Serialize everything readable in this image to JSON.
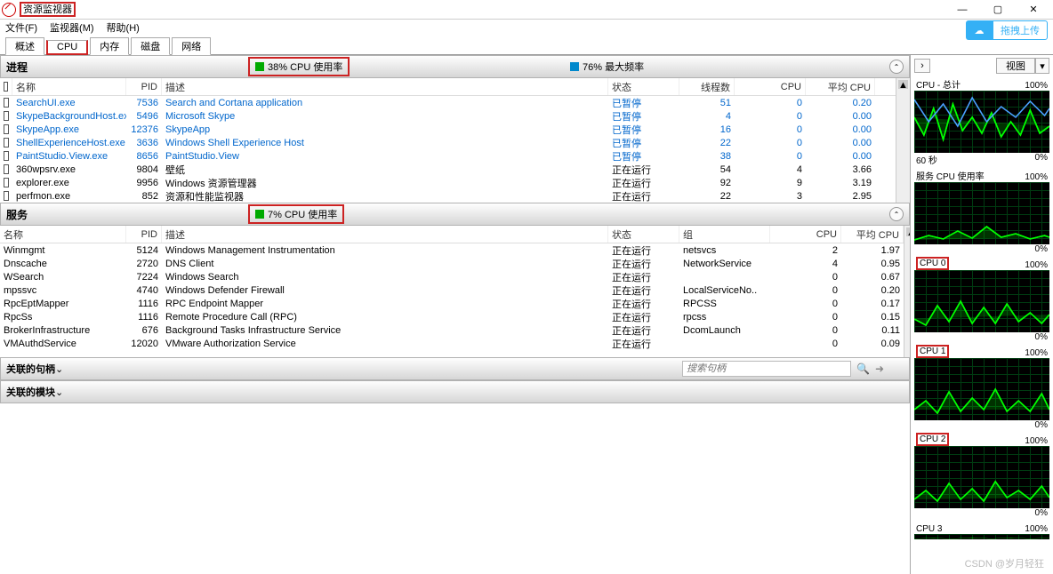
{
  "window": {
    "title": "资源监视器"
  },
  "menu": {
    "file": "文件(F)",
    "monitor": "监视器(M)",
    "help": "帮助(H)"
  },
  "upload_btn": "拖拽上传",
  "tabs": {
    "overview": "概述",
    "cpu": "CPU",
    "memory": "内存",
    "disk": "磁盘",
    "network": "网络"
  },
  "proc_section": {
    "title": "进程",
    "stat1": "38% CPU 使用率",
    "stat2": "76% 最大频率",
    "headers": {
      "name": "名称",
      "pid": "PID",
      "desc": "描述",
      "status": "状态",
      "threads": "线程数",
      "cpu": "CPU",
      "avgcpu": "平均 CPU"
    },
    "rows": [
      {
        "name": "SearchUI.exe",
        "pid": "7536",
        "desc": "Search and Cortana application",
        "status": "已暂停",
        "threads": "51",
        "cpu": "0",
        "avg": "0.20",
        "link": true
      },
      {
        "name": "SkypeBackgroundHost.exe",
        "pid": "5496",
        "desc": "Microsoft Skype",
        "status": "已暂停",
        "threads": "4",
        "cpu": "0",
        "avg": "0.00",
        "link": true
      },
      {
        "name": "SkypeApp.exe",
        "pid": "12376",
        "desc": "SkypeApp",
        "status": "已暂停",
        "threads": "16",
        "cpu": "0",
        "avg": "0.00",
        "link": true
      },
      {
        "name": "ShellExperienceHost.exe",
        "pid": "3636",
        "desc": "Windows Shell Experience Host",
        "status": "已暂停",
        "threads": "22",
        "cpu": "0",
        "avg": "0.00",
        "link": true
      },
      {
        "name": "PaintStudio.View.exe",
        "pid": "8656",
        "desc": "PaintStudio.View",
        "status": "已暂停",
        "threads": "38",
        "cpu": "0",
        "avg": "0.00",
        "link": true
      },
      {
        "name": "360wpsrv.exe",
        "pid": "9804",
        "desc": "壁纸",
        "status": "正在运行",
        "threads": "54",
        "cpu": "4",
        "avg": "3.66",
        "link": false
      },
      {
        "name": "explorer.exe",
        "pid": "9956",
        "desc": "Windows 资源管理器",
        "status": "正在运行",
        "threads": "92",
        "cpu": "9",
        "avg": "3.19",
        "link": false
      },
      {
        "name": "perfmon.exe",
        "pid": "852",
        "desc": "资源和性能监视器",
        "status": "正在运行",
        "threads": "22",
        "cpu": "3",
        "avg": "2.95",
        "link": false
      }
    ]
  },
  "svc_section": {
    "title": "服务",
    "stat1": "7% CPU 使用率",
    "headers": {
      "name": "名称",
      "pid": "PID",
      "desc": "描述",
      "status": "状态",
      "group": "组",
      "cpu": "CPU",
      "avgcpu": "平均 CPU"
    },
    "rows": [
      {
        "name": "Winmgmt",
        "pid": "5124",
        "desc": "Windows Management Instrumentation",
        "status": "正在运行",
        "group": "netsvcs",
        "cpu": "2",
        "avg": "1.97"
      },
      {
        "name": "Dnscache",
        "pid": "2720",
        "desc": "DNS Client",
        "status": "正在运行",
        "group": "NetworkService",
        "cpu": "4",
        "avg": "0.95"
      },
      {
        "name": "WSearch",
        "pid": "7224",
        "desc": "Windows Search",
        "status": "正在运行",
        "group": "",
        "cpu": "0",
        "avg": "0.67"
      },
      {
        "name": "mpssvc",
        "pid": "4740",
        "desc": "Windows Defender Firewall",
        "status": "正在运行",
        "group": "LocalServiceNo..",
        "cpu": "0",
        "avg": "0.20"
      },
      {
        "name": "RpcEptMapper",
        "pid": "1116",
        "desc": "RPC Endpoint Mapper",
        "status": "正在运行",
        "group": "RPCSS",
        "cpu": "0",
        "avg": "0.17"
      },
      {
        "name": "RpcSs",
        "pid": "1116",
        "desc": "Remote Procedure Call (RPC)",
        "status": "正在运行",
        "group": "rpcss",
        "cpu": "0",
        "avg": "0.15"
      },
      {
        "name": "BrokerInfrastructure",
        "pid": "676",
        "desc": "Background Tasks Infrastructure Service",
        "status": "正在运行",
        "group": "DcomLaunch",
        "cpu": "0",
        "avg": "0.11"
      },
      {
        "name": "VMAuthdService",
        "pid": "12020",
        "desc": "VMware Authorization Service",
        "status": "正在运行",
        "group": "",
        "cpu": "0",
        "avg": "0.09"
      }
    ]
  },
  "handles_section": {
    "title": "关联的句柄",
    "search_placeholder": "搜索句柄"
  },
  "modules_section": {
    "title": "关联的模块"
  },
  "right_panel": {
    "view_btn": "视图",
    "graphs": [
      {
        "title": "CPU - 总计",
        "max": "100%",
        "foot_left": "60 秒",
        "foot_right": "0%",
        "hl": false,
        "blue": true
      },
      {
        "title": "服务 CPU 使用率",
        "max": "100%",
        "foot_left": "",
        "foot_right": "0%",
        "hl": false,
        "blue": false
      },
      {
        "title": "CPU 0",
        "max": "100%",
        "foot_left": "",
        "foot_right": "0%",
        "hl": true,
        "blue": false
      },
      {
        "title": "CPU 1",
        "max": "100%",
        "foot_left": "",
        "foot_right": "0%",
        "hl": true,
        "blue": false
      },
      {
        "title": "CPU 2",
        "max": "100%",
        "foot_left": "",
        "foot_right": "0%",
        "hl": true,
        "blue": false
      },
      {
        "title": "CPU 3",
        "max": "100%",
        "foot_left": "",
        "foot_right": "",
        "hl": false,
        "blue": false
      }
    ]
  },
  "watermark": "CSDN @岁月轻狂"
}
